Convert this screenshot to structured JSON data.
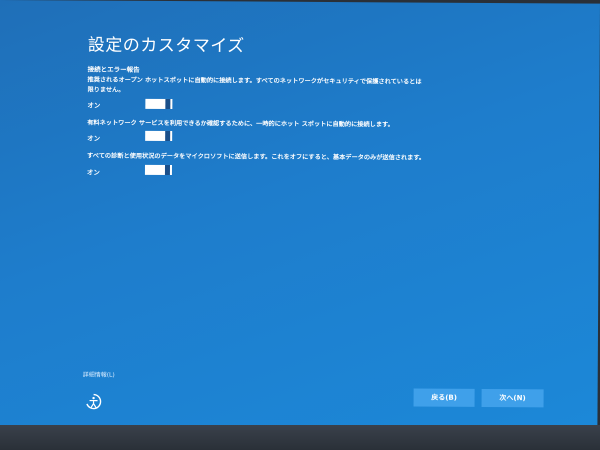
{
  "page": {
    "title": "設定のカスタマイズ"
  },
  "section": {
    "heading": "接続とエラー報告"
  },
  "settings": [
    {
      "description": "推奨されるオープン ホットスポットに自動的に接続します。すべてのネットワークがセキュリティで保護されているとは限りません。",
      "state_label": "オン",
      "enabled": true
    },
    {
      "description": "有料ネットワーク サービスを利用できるか確認するために、一時的にホット スポットに自動的に接続します。",
      "state_label": "オン",
      "enabled": true
    },
    {
      "description": "すべての診断と使用状況のデータをマイクロソフトに送信します。これをオフにすると、基本データのみが送信されます。",
      "state_label": "オン",
      "enabled": true
    }
  ],
  "footer": {
    "details_link": "詳細情報(L)",
    "accessibility_icon": "ease-of-access-icon",
    "back_label": "戻る(B)",
    "next_label": "次へ(N)"
  },
  "colors": {
    "background": "#1e7dcc",
    "button": "#3fa0ea",
    "toggle_track": "#ffffff",
    "toggle_thumb": "#1a4f8a"
  }
}
